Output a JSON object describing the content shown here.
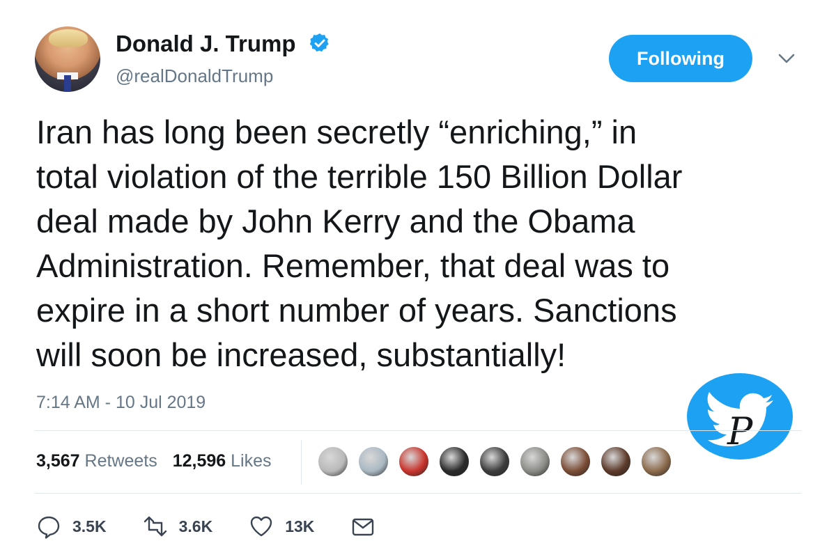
{
  "user": {
    "name": "Donald J. Trump",
    "handle": "@realDonaldTrump",
    "verified_icon": "verified-badge-icon",
    "follow_button_label": "Following"
  },
  "tweet": {
    "text": "Iran has long been secretly “enriching,” in\ntotal violation of the terrible 150 Billion Dollar\ndeal made by John Kerry and the Obama\nAdministration. Remember, that deal was to\nexpire in a short number of years. Sanctions\nwill soon be increased, substantially!",
    "timestamp": "7:14 AM - 10 Jul 2019"
  },
  "stats": {
    "retweets_count": "3,567",
    "retweets_label": "Retweets",
    "likes_count": "12,596",
    "likes_label": "Likes"
  },
  "likers": [
    {
      "color": "#b9b9b9"
    },
    {
      "color": "#aab8c2"
    },
    {
      "color": "#c8342c"
    },
    {
      "color": "#2b2b2b"
    },
    {
      "color": "#3c3c3c"
    },
    {
      "color": "#8a8a86"
    },
    {
      "color": "#7b4d36"
    },
    {
      "color": "#5c3a2a"
    },
    {
      "color": "#8c6b4c"
    }
  ],
  "actions": {
    "reply_count": "3.5K",
    "retweet_count": "3.6K",
    "like_count": "13K"
  },
  "colors": {
    "accent": "#1da1f2",
    "secondary_text": "#657786",
    "divider": "#e1e8ed"
  }
}
